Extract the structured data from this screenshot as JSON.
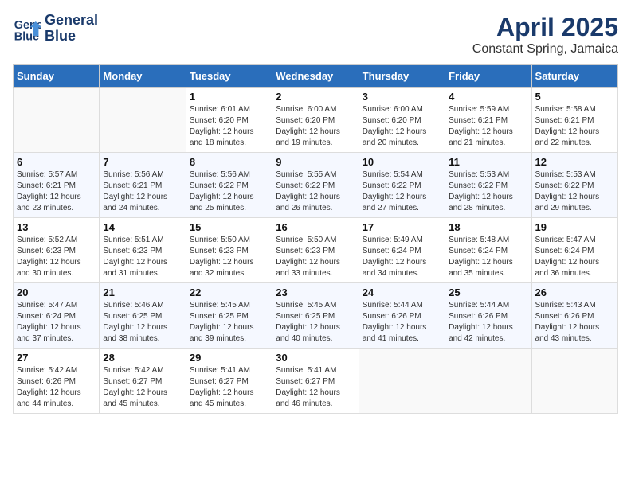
{
  "header": {
    "logo_line1": "General",
    "logo_line2": "Blue",
    "month": "April 2025",
    "location": "Constant Spring, Jamaica"
  },
  "days_of_week": [
    "Sunday",
    "Monday",
    "Tuesday",
    "Wednesday",
    "Thursday",
    "Friday",
    "Saturday"
  ],
  "weeks": [
    [
      null,
      null,
      {
        "day": 1,
        "sunrise": "6:01 AM",
        "sunset": "6:20 PM",
        "daylight": "12 hours and 18 minutes."
      },
      {
        "day": 2,
        "sunrise": "6:00 AM",
        "sunset": "6:20 PM",
        "daylight": "12 hours and 19 minutes."
      },
      {
        "day": 3,
        "sunrise": "6:00 AM",
        "sunset": "6:20 PM",
        "daylight": "12 hours and 20 minutes."
      },
      {
        "day": 4,
        "sunrise": "5:59 AM",
        "sunset": "6:21 PM",
        "daylight": "12 hours and 21 minutes."
      },
      {
        "day": 5,
        "sunrise": "5:58 AM",
        "sunset": "6:21 PM",
        "daylight": "12 hours and 22 minutes."
      }
    ],
    [
      {
        "day": 6,
        "sunrise": "5:57 AM",
        "sunset": "6:21 PM",
        "daylight": "12 hours and 23 minutes."
      },
      {
        "day": 7,
        "sunrise": "5:56 AM",
        "sunset": "6:21 PM",
        "daylight": "12 hours and 24 minutes."
      },
      {
        "day": 8,
        "sunrise": "5:56 AM",
        "sunset": "6:22 PM",
        "daylight": "12 hours and 25 minutes."
      },
      {
        "day": 9,
        "sunrise": "5:55 AM",
        "sunset": "6:22 PM",
        "daylight": "12 hours and 26 minutes."
      },
      {
        "day": 10,
        "sunrise": "5:54 AM",
        "sunset": "6:22 PM",
        "daylight": "12 hours and 27 minutes."
      },
      {
        "day": 11,
        "sunrise": "5:53 AM",
        "sunset": "6:22 PM",
        "daylight": "12 hours and 28 minutes."
      },
      {
        "day": 12,
        "sunrise": "5:53 AM",
        "sunset": "6:22 PM",
        "daylight": "12 hours and 29 minutes."
      }
    ],
    [
      {
        "day": 13,
        "sunrise": "5:52 AM",
        "sunset": "6:23 PM",
        "daylight": "12 hours and 30 minutes."
      },
      {
        "day": 14,
        "sunrise": "5:51 AM",
        "sunset": "6:23 PM",
        "daylight": "12 hours and 31 minutes."
      },
      {
        "day": 15,
        "sunrise": "5:50 AM",
        "sunset": "6:23 PM",
        "daylight": "12 hours and 32 minutes."
      },
      {
        "day": 16,
        "sunrise": "5:50 AM",
        "sunset": "6:23 PM",
        "daylight": "12 hours and 33 minutes."
      },
      {
        "day": 17,
        "sunrise": "5:49 AM",
        "sunset": "6:24 PM",
        "daylight": "12 hours and 34 minutes."
      },
      {
        "day": 18,
        "sunrise": "5:48 AM",
        "sunset": "6:24 PM",
        "daylight": "12 hours and 35 minutes."
      },
      {
        "day": 19,
        "sunrise": "5:47 AM",
        "sunset": "6:24 PM",
        "daylight": "12 hours and 36 minutes."
      }
    ],
    [
      {
        "day": 20,
        "sunrise": "5:47 AM",
        "sunset": "6:24 PM",
        "daylight": "12 hours and 37 minutes."
      },
      {
        "day": 21,
        "sunrise": "5:46 AM",
        "sunset": "6:25 PM",
        "daylight": "12 hours and 38 minutes."
      },
      {
        "day": 22,
        "sunrise": "5:45 AM",
        "sunset": "6:25 PM",
        "daylight": "12 hours and 39 minutes."
      },
      {
        "day": 23,
        "sunrise": "5:45 AM",
        "sunset": "6:25 PM",
        "daylight": "12 hours and 40 minutes."
      },
      {
        "day": 24,
        "sunrise": "5:44 AM",
        "sunset": "6:26 PM",
        "daylight": "12 hours and 41 minutes."
      },
      {
        "day": 25,
        "sunrise": "5:44 AM",
        "sunset": "6:26 PM",
        "daylight": "12 hours and 42 minutes."
      },
      {
        "day": 26,
        "sunrise": "5:43 AM",
        "sunset": "6:26 PM",
        "daylight": "12 hours and 43 minutes."
      }
    ],
    [
      {
        "day": 27,
        "sunrise": "5:42 AM",
        "sunset": "6:26 PM",
        "daylight": "12 hours and 44 minutes."
      },
      {
        "day": 28,
        "sunrise": "5:42 AM",
        "sunset": "6:27 PM",
        "daylight": "12 hours and 45 minutes."
      },
      {
        "day": 29,
        "sunrise": "5:41 AM",
        "sunset": "6:27 PM",
        "daylight": "12 hours and 45 minutes."
      },
      {
        "day": 30,
        "sunrise": "5:41 AM",
        "sunset": "6:27 PM",
        "daylight": "12 hours and 46 minutes."
      },
      null,
      null,
      null
    ]
  ],
  "labels": {
    "sunrise": "Sunrise:",
    "sunset": "Sunset:",
    "daylight": "Daylight:"
  }
}
